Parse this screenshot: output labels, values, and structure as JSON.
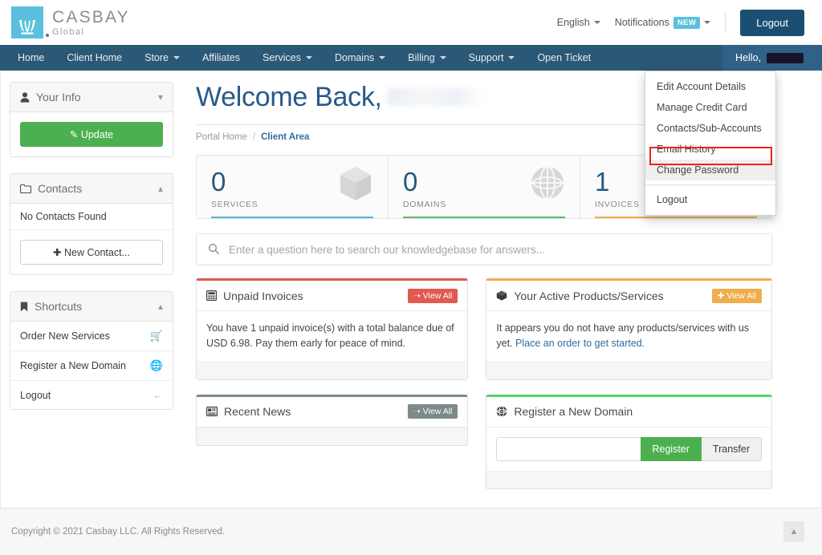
{
  "brand": {
    "name": "CASBAY",
    "sub": "Global",
    "logo_icon": "casbay-crown-logo"
  },
  "topbar": {
    "language": "English",
    "notifications": "Notifications",
    "notifications_badge": "NEW",
    "logout": "Logout"
  },
  "nav": {
    "items": [
      {
        "label": "Home",
        "caret": false
      },
      {
        "label": "Client Home",
        "caret": false
      },
      {
        "label": "Store",
        "caret": true
      },
      {
        "label": "Affiliates",
        "caret": false
      },
      {
        "label": "Services",
        "caret": true
      },
      {
        "label": "Domains",
        "caret": true
      },
      {
        "label": "Billing",
        "caret": true
      },
      {
        "label": "Support",
        "caret": true
      },
      {
        "label": "Open Ticket",
        "caret": false
      }
    ],
    "user_greeting": "Hello,",
    "user_name_redacted": true
  },
  "user_dropdown": {
    "items": [
      {
        "label": "Edit Account Details",
        "highlighted": false
      },
      {
        "label": "Manage Credit Card",
        "highlighted": false
      },
      {
        "label": "Contacts/Sub-Accounts",
        "highlighted": false
      },
      {
        "label": "Email History",
        "highlighted": false
      },
      {
        "label": "Change Password",
        "highlighted": true
      }
    ],
    "logout": "Logout",
    "highlight_color": "#ee2222"
  },
  "sidebar": {
    "your_info": {
      "title": "Your Info",
      "icon": "user-icon",
      "chevron": "chevron-down-icon",
      "update_button": "Update",
      "update_icon": "pencil-icon"
    },
    "contacts": {
      "title": "Contacts",
      "icon": "folder-icon",
      "chevron": "chevron-up-icon",
      "empty_text": "No Contacts Found",
      "new_contact_button": "New Contact...",
      "new_contact_icon": "plus-icon"
    },
    "shortcuts": {
      "title": "Shortcuts",
      "icon": "bookmark-icon",
      "chevron": "chevron-up-icon",
      "items": [
        {
          "label": "Order New Services",
          "icon": "shopping-cart-icon"
        },
        {
          "label": "Register a New Domain",
          "icon": "globe-icon"
        },
        {
          "label": "Logout",
          "icon": "arrow-left-icon"
        }
      ]
    }
  },
  "main": {
    "welcome_title": "Welcome Back,",
    "breadcrumb": {
      "home": "Portal Home",
      "separator": "/",
      "current": "Client Area"
    },
    "stats": [
      {
        "value": "0",
        "label": "SERVICES",
        "color": "#5bafe0",
        "icon": "box-icon"
      },
      {
        "value": "0",
        "label": "DOMAINS",
        "color": "#5cb85c",
        "icon": "globe-icon"
      },
      {
        "value": "1",
        "label": "INVOICES",
        "color": "#f0ad4e",
        "icon": "invoice-icon"
      }
    ],
    "search": {
      "placeholder": "Enter a question here to search our knowledgebase for answers...",
      "icon": "search-icon"
    },
    "cards": [
      {
        "title": "Unpaid Invoices",
        "icon": "calculator-icon",
        "accent": "#e05a51",
        "view_all": "View All",
        "view_all_icon": "arrow-right-icon",
        "body": "You have 1 unpaid invoice(s) with a total balance due of USD 6.98. Pay them early for peace of mind.",
        "link": ""
      },
      {
        "title": "Your Active Products/Services",
        "icon": "box-icon",
        "accent": "#f0ad4e",
        "view_all": "View All",
        "view_all_icon": "plus-icon",
        "body": "It appears you do not have any products/services with us yet.",
        "link": "Place an order to get started."
      },
      {
        "title": "Recent News",
        "icon": "newspaper-icon",
        "accent": "#7c8a8a",
        "view_all": "View All",
        "view_all_icon": "arrow-right-icon",
        "body": "",
        "link": ""
      },
      {
        "title": "Register a New Domain",
        "icon": "globe-icon",
        "accent": "#4cd964",
        "view_all": "",
        "view_all_icon": "",
        "body": "",
        "link": ""
      }
    ],
    "domain_form": {
      "input_value": "",
      "register_button": "Register",
      "transfer_button": "Transfer"
    }
  },
  "footer": {
    "copyright": "Copyright © 2021 Casbay LLC. All Rights Reserved.",
    "scroll_top_icon": "chevron-up-icon"
  }
}
